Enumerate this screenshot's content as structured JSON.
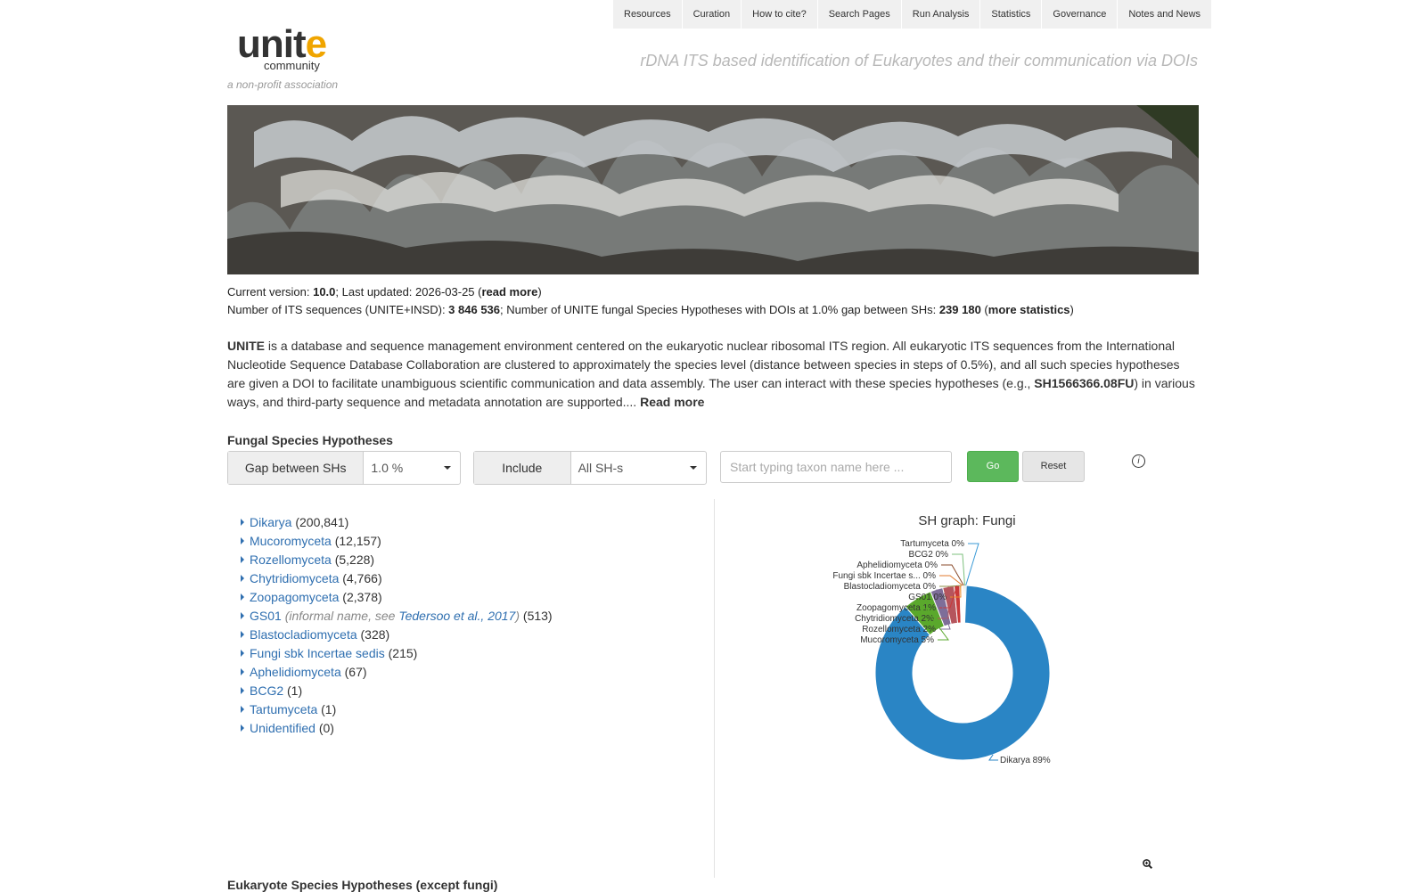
{
  "nav": [
    "Resources",
    "Curation",
    "How to cite?",
    "Search Pages",
    "Run Analysis",
    "Statistics",
    "Governance",
    "Notes and News"
  ],
  "logo": {
    "word_a": "unit",
    "word_b": "e",
    "sub": "community"
  },
  "tagline": "a non-profit association",
  "headline": "rDNA ITS based identification of Eukaryotes and their communication via DOIs",
  "version_line": {
    "prefix": "Current version: ",
    "version": "10.0",
    "mid": "; Last updated: 2026-03-25 (",
    "link": "read more",
    "suffix": ")"
  },
  "stats_line": {
    "prefix": "Number of ITS sequences (UNITE+INSD): ",
    "seq_count": "3 846 536",
    "mid": "; Number of UNITE fungal Species Hypotheses with DOIs at 1.0% gap between SHs: ",
    "sh_count": "239 180",
    "paren_open": " (",
    "link": "more statistics",
    "paren_close": ")"
  },
  "description": {
    "brand": "UNITE",
    "text": " is a database and sequence management environment centered on the eukaryotic nuclear ribosomal ITS region. All eukaryotic ITS sequences from the International Nucleotide Sequence Database Collaboration are clustered to approximately the species level (distance between species in steps of 0.5%), and all such species hypotheses are given a DOI to facilitate unambiguous scientific communication and data assembly. The user can interact with these species hypotheses (e.g., ",
    "example": "SH1566366.08FU",
    "text2": ") in various ways, and third-party sequence and metadata annotation are supported.... ",
    "read_more": "Read more"
  },
  "fungal_title": "Fungal Species Hypotheses",
  "filters": {
    "gap_label": "Gap between SHs",
    "gap_value": "1.0 %",
    "include_label": "Include",
    "include_value": "All SH-s",
    "search_placeholder": "Start typing taxon name here ...",
    "go": "Go",
    "reset": "Reset"
  },
  "tree": [
    {
      "name": "Dikarya",
      "count": "(200,841)"
    },
    {
      "name": "Mucoromyceta",
      "count": "(12,157)"
    },
    {
      "name": "Rozellomyceta",
      "count": "(5,228)"
    },
    {
      "name": "Chytridiomyceta",
      "count": "(4,766)"
    },
    {
      "name": "Zoopagomyceta",
      "count": "(2,378)"
    },
    {
      "name": "GS01",
      "note_pre": "(informal name, see ",
      "note_link": "Tedersoo et al., 2017",
      "note_post": ")",
      "count": "(513)"
    },
    {
      "name": "Blastocladiomyceta",
      "count": "(328)"
    },
    {
      "name": "Fungi sbk Incertae sedis",
      "count": "(215)"
    },
    {
      "name": "Aphelidiomyceta",
      "count": "(67)"
    },
    {
      "name": "BCG2",
      "count": "(1)"
    },
    {
      "name": "Tartumyceta",
      "count": "(1)"
    },
    {
      "name": "Unidentified",
      "count": "(0)"
    }
  ],
  "chart_title": "SH graph: Fungi",
  "chart_data": {
    "type": "pie",
    "donut": true,
    "categories": [
      "Dikarya",
      "Mucoromyceta",
      "Rozellomyceta",
      "Chytridiomyceta",
      "Zoopagomyceta",
      "GS01",
      "Blastocladiomyceta",
      "Fungi sbk Incertae s...",
      "Aphelidiomyceta",
      "BCG2",
      "Tartumyceta"
    ],
    "values": [
      200841,
      12157,
      5228,
      4766,
      2378,
      513,
      328,
      215,
      67,
      1,
      1
    ],
    "labels": [
      "89%",
      "5%",
      "2%",
      "2%",
      "1%",
      "0%",
      "0%",
      "0%",
      "0%",
      "0%",
      "0%"
    ],
    "colors": [
      "#2a85c5",
      "#5aa82c",
      "#7e6e99",
      "#b5555d",
      "#c93a3a",
      "#f08a24",
      "#8e8e44",
      "#e07a2e",
      "#8a4a2a",
      "#7cc07c",
      "#3a9ad6"
    ]
  },
  "bottom_title": "Eukaryote Species Hypotheses (except fungi)"
}
